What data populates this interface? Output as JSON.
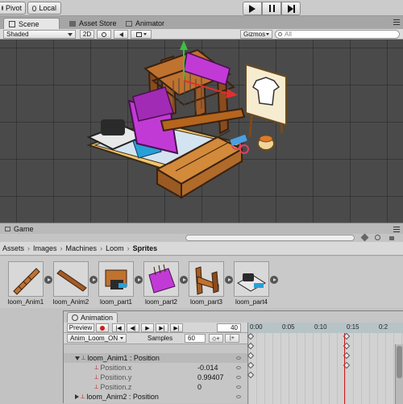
{
  "toolbar": {
    "pivot_label": "Pivot",
    "local_label": "Local"
  },
  "tabs": {
    "scene": "Scene",
    "asset_store": "Asset Store",
    "animator": "Animator"
  },
  "scene_toolbar": {
    "shading_mode": "Shaded",
    "mode_2d": "2D",
    "gizmos": "Gizmos",
    "search_placeholder": "All"
  },
  "game_tab": "Game",
  "breadcrumb": [
    "Assets",
    "Images",
    "Machines",
    "Loom",
    "Sprites"
  ],
  "assets": [
    {
      "label": "loom_Anim1"
    },
    {
      "label": "loom_Anim2"
    },
    {
      "label": "loom_part1"
    },
    {
      "label": "loom_part2"
    },
    {
      "label": "loom_part3"
    },
    {
      "label": "loom_part4"
    }
  ],
  "animation": {
    "tab_title": "Animation",
    "preview_label": "Preview",
    "frame": "40",
    "clip": "Anim_Loom_ON",
    "samples_label": "Samples",
    "samples": "60",
    "timeline_ticks": [
      "0:00",
      "0:05",
      "0:10",
      "0:15",
      "0:2"
    ],
    "rows": [
      {
        "label": "loom_Anim1 : Position",
        "value": ""
      },
      {
        "label": "Position.x",
        "value": "-0.014"
      },
      {
        "label": "Position.y",
        "value": "0.99407"
      },
      {
        "label": "Position.z",
        "value": "0"
      },
      {
        "label": "loom_Anim2 : Position",
        "value": ""
      }
    ]
  },
  "colors": {
    "accent_green": "#3fbf3f",
    "loom_purple": "#c23ad6",
    "wood": "#b5651d",
    "scene_bg": "#4a4a4a"
  }
}
